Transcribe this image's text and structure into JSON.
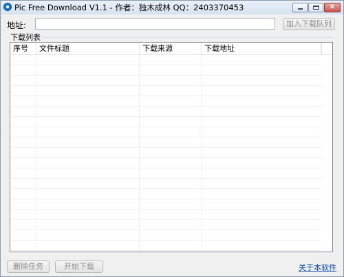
{
  "window": {
    "title": "Pic Free Download V1.1 - 作者：独木成林 QQ：2403370453"
  },
  "address": {
    "label": "地址:",
    "value": "",
    "placeholder": ""
  },
  "toolbar": {
    "add_button": "加入下载队列"
  },
  "download_list": {
    "group_label": "下载列表",
    "columns": [
      "序号",
      "文件标题",
      "下载来源",
      "下载地址"
    ],
    "rows": []
  },
  "footer": {
    "delete_button": "删除任务",
    "start_button": "开始下载",
    "about_link": "关于本软件"
  }
}
